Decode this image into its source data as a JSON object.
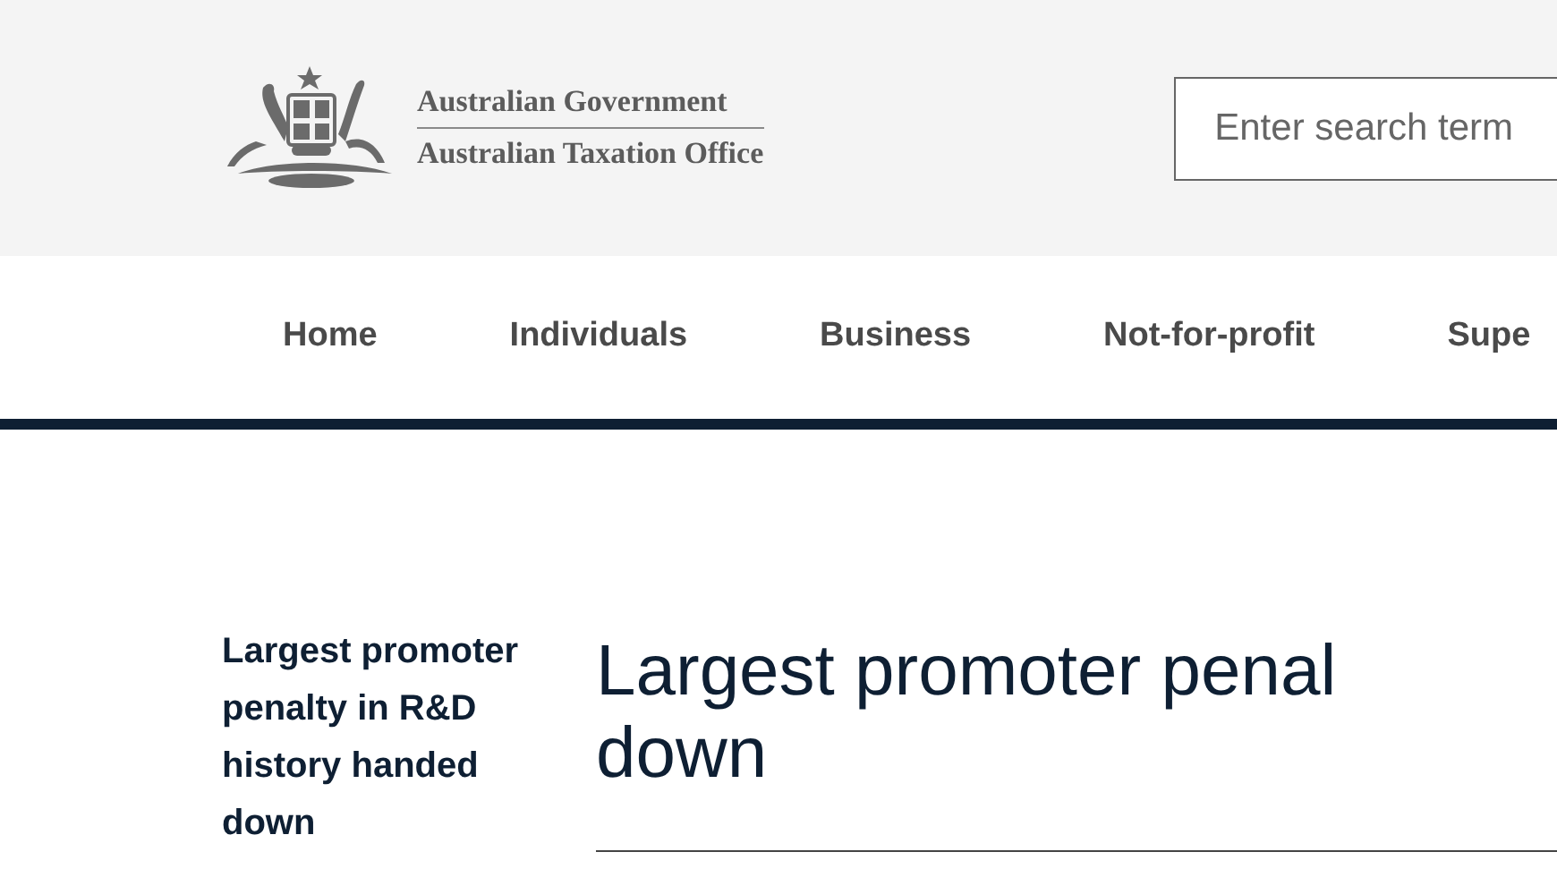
{
  "header": {
    "agency_lines": [
      "Australian Government",
      "Australian Taxation Office"
    ],
    "search": {
      "placeholder": "Enter search term"
    }
  },
  "nav": {
    "items": [
      {
        "label": "Home"
      },
      {
        "label": "Individuals"
      },
      {
        "label": "Business"
      },
      {
        "label": "Not-for-profit"
      },
      {
        "label": "Supe"
      }
    ]
  },
  "sidebar": {
    "title": "Largest promoter penalty in R&D history handed down"
  },
  "article": {
    "title_lines": [
      "Largest promoter penal",
      "down"
    ]
  }
}
